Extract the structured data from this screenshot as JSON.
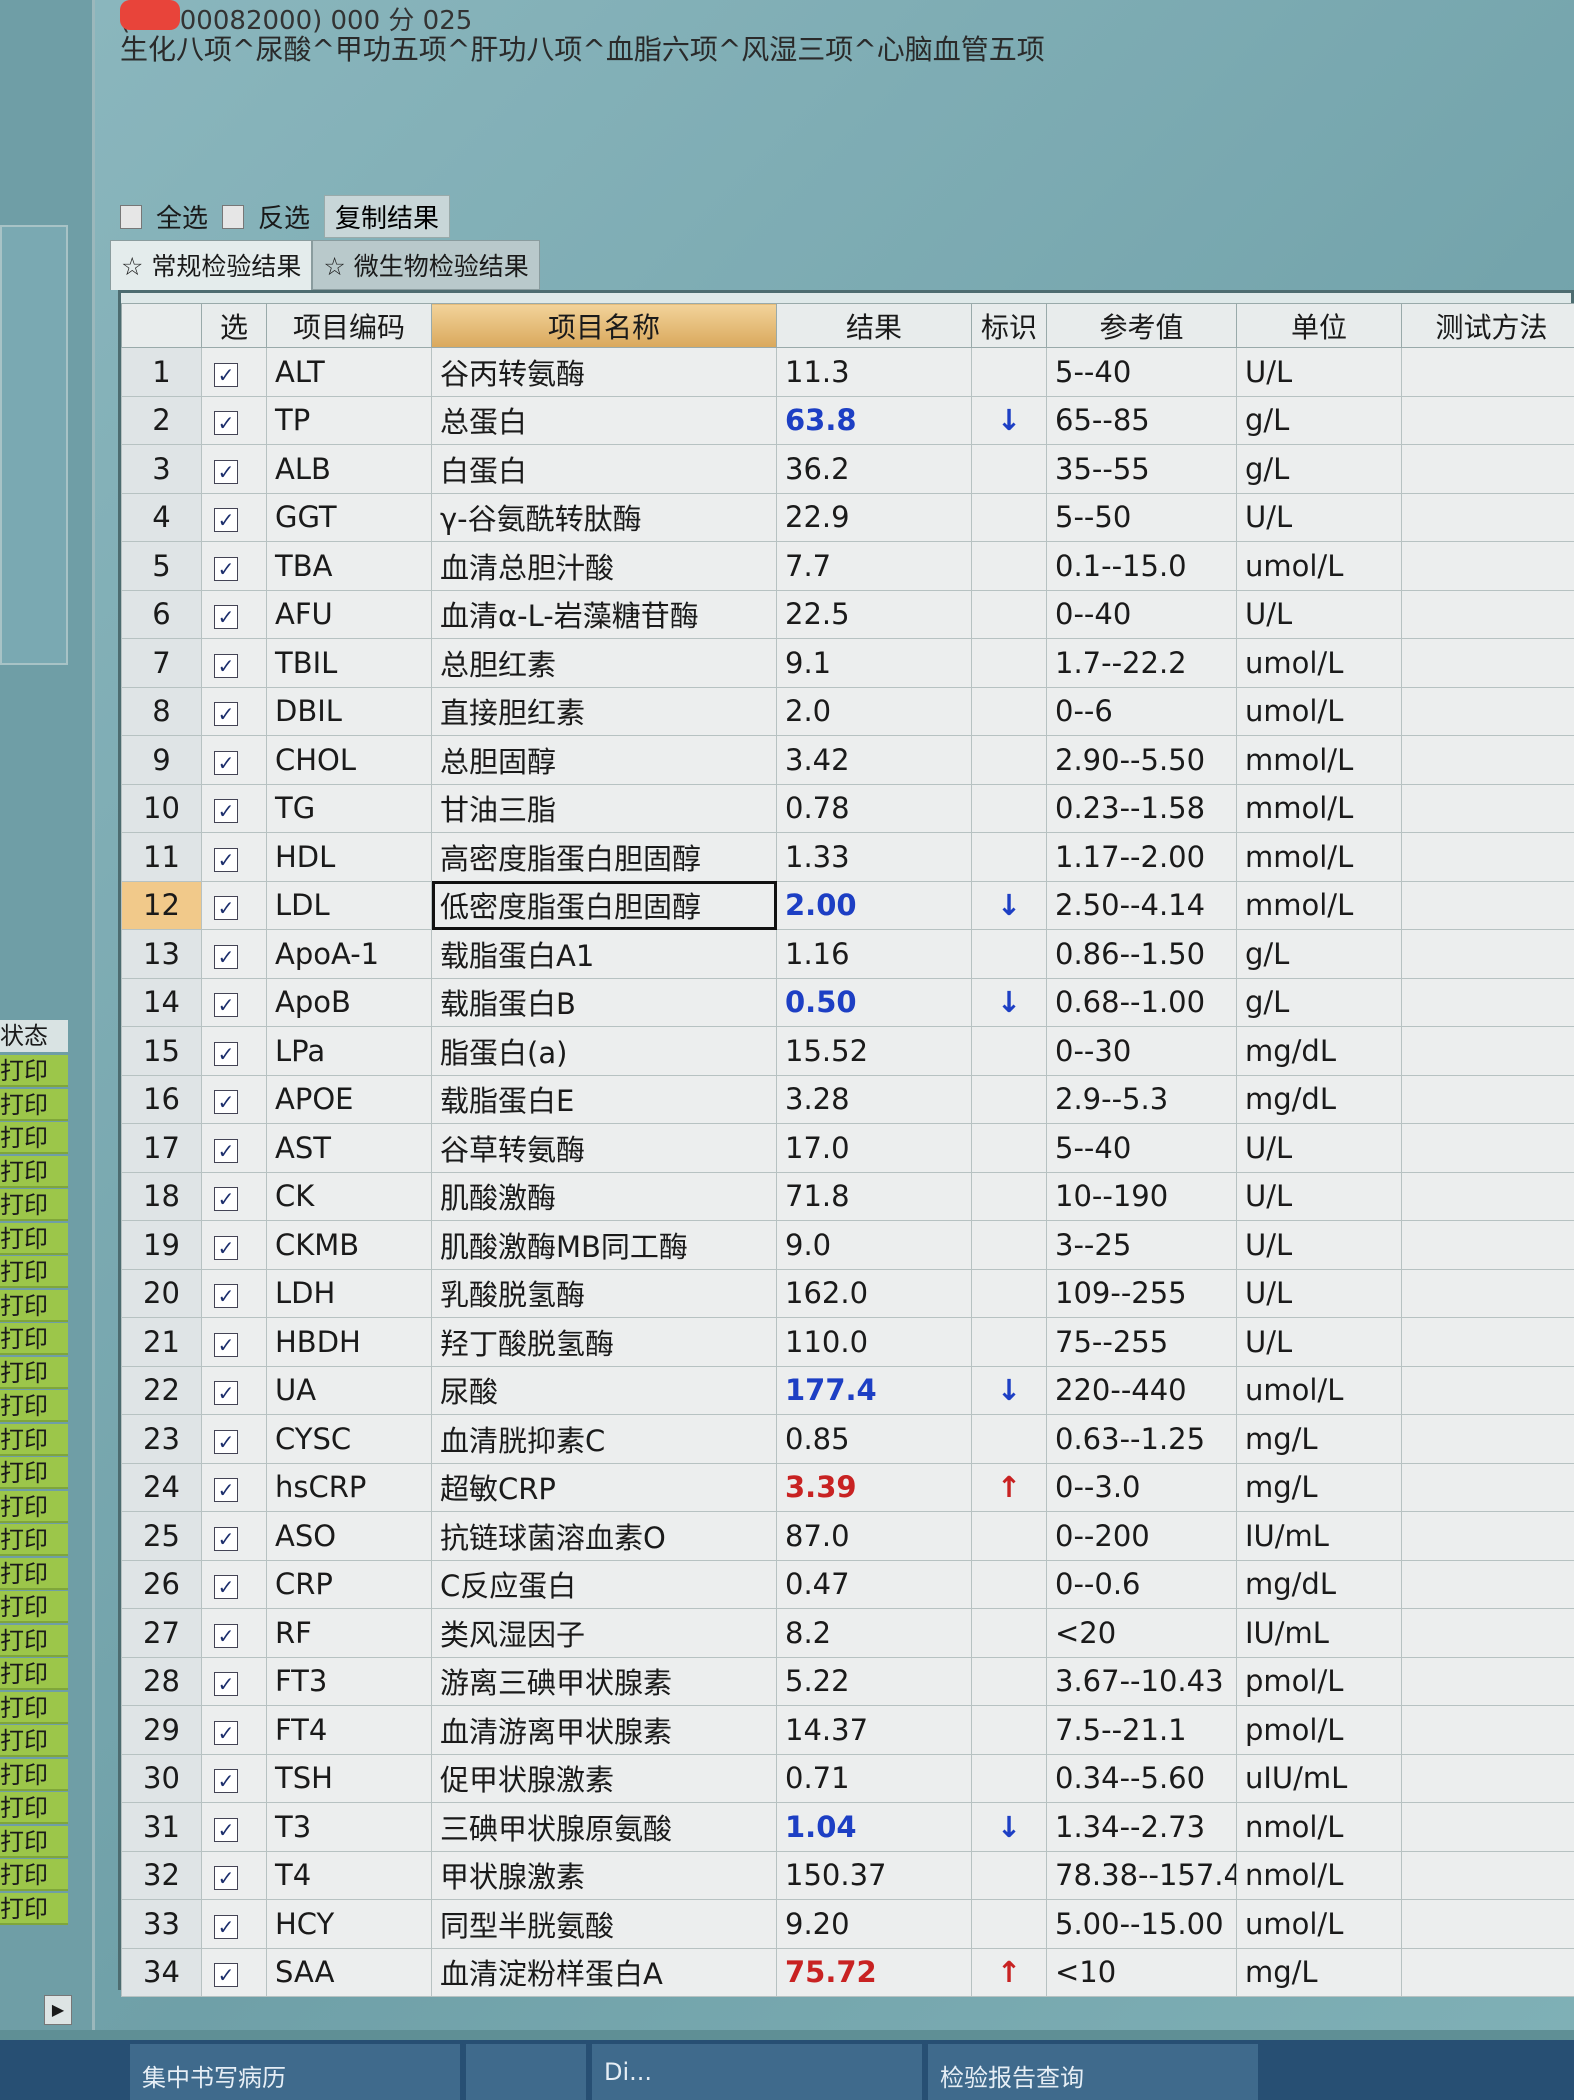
{
  "header": {
    "patient_line": "(00000082000) 000 分 025",
    "tests": "生化八项^尿酸^甲功五项^肝功八项^血脂六项^风湿三项^心脑血管五项"
  },
  "toolbar": {
    "select_all": "全选",
    "invert": "反选",
    "copy": "复制结果"
  },
  "tabs": [
    {
      "label": "☆ 常规检验结果"
    },
    {
      "label": "☆ 微生物检验结果"
    }
  ],
  "left_panel": {
    "status_header": "状态",
    "status_value": "打印"
  },
  "table": {
    "columns": [
      "",
      "选",
      "项目编码",
      "项目名称",
      "结果",
      "标识",
      "参考值",
      "单位",
      "测试方法"
    ],
    "rows": [
      {
        "n": "1",
        "code": "ALT",
        "name": "谷丙转氨酶",
        "result": "11.3",
        "flag": "",
        "ref": "5--40",
        "unit": "U/L"
      },
      {
        "n": "2",
        "code": "TP",
        "name": "总蛋白",
        "result": "63.8",
        "flag": "low",
        "ref": "65--85",
        "unit": "g/L"
      },
      {
        "n": "3",
        "code": "ALB",
        "name": "白蛋白",
        "result": "36.2",
        "flag": "",
        "ref": "35--55",
        "unit": "g/L"
      },
      {
        "n": "4",
        "code": "GGT",
        "name": "γ-谷氨酰转肽酶",
        "result": "22.9",
        "flag": "",
        "ref": "5--50",
        "unit": "U/L"
      },
      {
        "n": "5",
        "code": "TBA",
        "name": "血清总胆汁酸",
        "result": "7.7",
        "flag": "",
        "ref": "0.1--15.0",
        "unit": "umol/L"
      },
      {
        "n": "6",
        "code": "AFU",
        "name": "血清α-L-岩藻糖苷酶",
        "result": "22.5",
        "flag": "",
        "ref": "0--40",
        "unit": "U/L"
      },
      {
        "n": "7",
        "code": "TBIL",
        "name": "总胆红素",
        "result": "9.1",
        "flag": "",
        "ref": "1.7--22.2",
        "unit": "umol/L"
      },
      {
        "n": "8",
        "code": "DBIL",
        "name": "直接胆红素",
        "result": "2.0",
        "flag": "",
        "ref": "0--6",
        "unit": "umol/L"
      },
      {
        "n": "9",
        "code": "CHOL",
        "name": "总胆固醇",
        "result": "3.42",
        "flag": "",
        "ref": "2.90--5.50",
        "unit": "mmol/L"
      },
      {
        "n": "10",
        "code": "TG",
        "name": "甘油三脂",
        "result": "0.78",
        "flag": "",
        "ref": "0.23--1.58",
        "unit": "mmol/L"
      },
      {
        "n": "11",
        "code": "HDL",
        "name": "高密度脂蛋白胆固醇",
        "result": "1.33",
        "flag": "",
        "ref": "1.17--2.00",
        "unit": "mmol/L"
      },
      {
        "n": "12",
        "code": "LDL",
        "name": "低密度脂蛋白胆固醇",
        "result": "2.00",
        "flag": "low",
        "ref": "2.50--4.14",
        "unit": "mmol/L"
      },
      {
        "n": "13",
        "code": "ApoA-1",
        "name": "载脂蛋白A1",
        "result": "1.16",
        "flag": "",
        "ref": "0.86--1.50",
        "unit": "g/L"
      },
      {
        "n": "14",
        "code": "ApoB",
        "name": "载脂蛋白B",
        "result": "0.50",
        "flag": "low",
        "ref": "0.68--1.00",
        "unit": "g/L"
      },
      {
        "n": "15",
        "code": "LPa",
        "name": "脂蛋白(a)",
        "result": "15.52",
        "flag": "",
        "ref": "0--30",
        "unit": "mg/dL"
      },
      {
        "n": "16",
        "code": "APOE",
        "name": "载脂蛋白E",
        "result": "3.28",
        "flag": "",
        "ref": "2.9--5.3",
        "unit": "mg/dL"
      },
      {
        "n": "17",
        "code": "AST",
        "name": "谷草转氨酶",
        "result": "17.0",
        "flag": "",
        "ref": "5--40",
        "unit": "U/L"
      },
      {
        "n": "18",
        "code": "CK",
        "name": "肌酸激酶",
        "result": "71.8",
        "flag": "",
        "ref": "10--190",
        "unit": "U/L"
      },
      {
        "n": "19",
        "code": "CKMB",
        "name": "肌酸激酶MB同工酶",
        "result": "9.0",
        "flag": "",
        "ref": "3--25",
        "unit": "U/L"
      },
      {
        "n": "20",
        "code": "LDH",
        "name": "乳酸脱氢酶",
        "result": "162.0",
        "flag": "",
        "ref": "109--255",
        "unit": "U/L"
      },
      {
        "n": "21",
        "code": "HBDH",
        "name": "羟丁酸脱氢酶",
        "result": "110.0",
        "flag": "",
        "ref": "75--255",
        "unit": "U/L"
      },
      {
        "n": "22",
        "code": "UA",
        "name": "尿酸",
        "result": "177.4",
        "flag": "low",
        "ref": "220--440",
        "unit": "umol/L"
      },
      {
        "n": "23",
        "code": "CYSC",
        "name": "血清胱抑素C",
        "result": "0.85",
        "flag": "",
        "ref": "0.63--1.25",
        "unit": "mg/L"
      },
      {
        "n": "24",
        "code": "hsCRP",
        "name": "超敏CRP",
        "result": "3.39",
        "flag": "high",
        "ref": "0--3.0",
        "unit": "mg/L"
      },
      {
        "n": "25",
        "code": "ASO",
        "name": "抗链球菌溶血素O",
        "result": "87.0",
        "flag": "",
        "ref": "0--200",
        "unit": "IU/mL"
      },
      {
        "n": "26",
        "code": "CRP",
        "name": "C反应蛋白",
        "result": "0.47",
        "flag": "",
        "ref": "0--0.6",
        "unit": "mg/dL"
      },
      {
        "n": "27",
        "code": "RF",
        "name": "类风湿因子",
        "result": "8.2",
        "flag": "",
        "ref": "<20",
        "unit": "IU/mL"
      },
      {
        "n": "28",
        "code": "FT3",
        "name": "游离三碘甲状腺素",
        "result": "5.22",
        "flag": "",
        "ref": "3.67--10.43",
        "unit": "pmol/L"
      },
      {
        "n": "29",
        "code": "FT4",
        "name": "血清游离甲状腺素",
        "result": "14.37",
        "flag": "",
        "ref": "7.5--21.1",
        "unit": "pmol/L"
      },
      {
        "n": "30",
        "code": "TSH",
        "name": "促甲状腺激素",
        "result": "0.71",
        "flag": "",
        "ref": "0.34--5.60",
        "unit": "uIU/mL"
      },
      {
        "n": "31",
        "code": "T3",
        "name": "三碘甲状腺原氨酸",
        "result": "1.04",
        "flag": "low",
        "ref": "1.34--2.73",
        "unit": "nmol/L"
      },
      {
        "n": "32",
        "code": "T4",
        "name": "甲状腺激素",
        "result": "150.37",
        "flag": "",
        "ref": "78.38--157.4",
        "unit": "nmol/L"
      },
      {
        "n": "33",
        "code": "HCY",
        "name": "同型半胱氨酸",
        "result": "9.20",
        "flag": "",
        "ref": "5.00--15.00",
        "unit": "umol/L"
      },
      {
        "n": "34",
        "code": "SAA",
        "name": "血清淀粉样蛋白A",
        "result": "75.72",
        "flag": "high",
        "ref": "<10",
        "unit": "mg/L"
      }
    ],
    "selected_row": "12",
    "arrows": {
      "low": "↓",
      "high": "↑"
    }
  },
  "taskbar": [
    {
      "label": "集中书写病历"
    },
    {
      "label": ""
    },
    {
      "label": "Di..."
    },
    {
      "label": "检验报告查询"
    }
  ],
  "colors": {
    "low": "#1d3fc4",
    "high": "#c82222",
    "status_green": "#9cc64a"
  }
}
